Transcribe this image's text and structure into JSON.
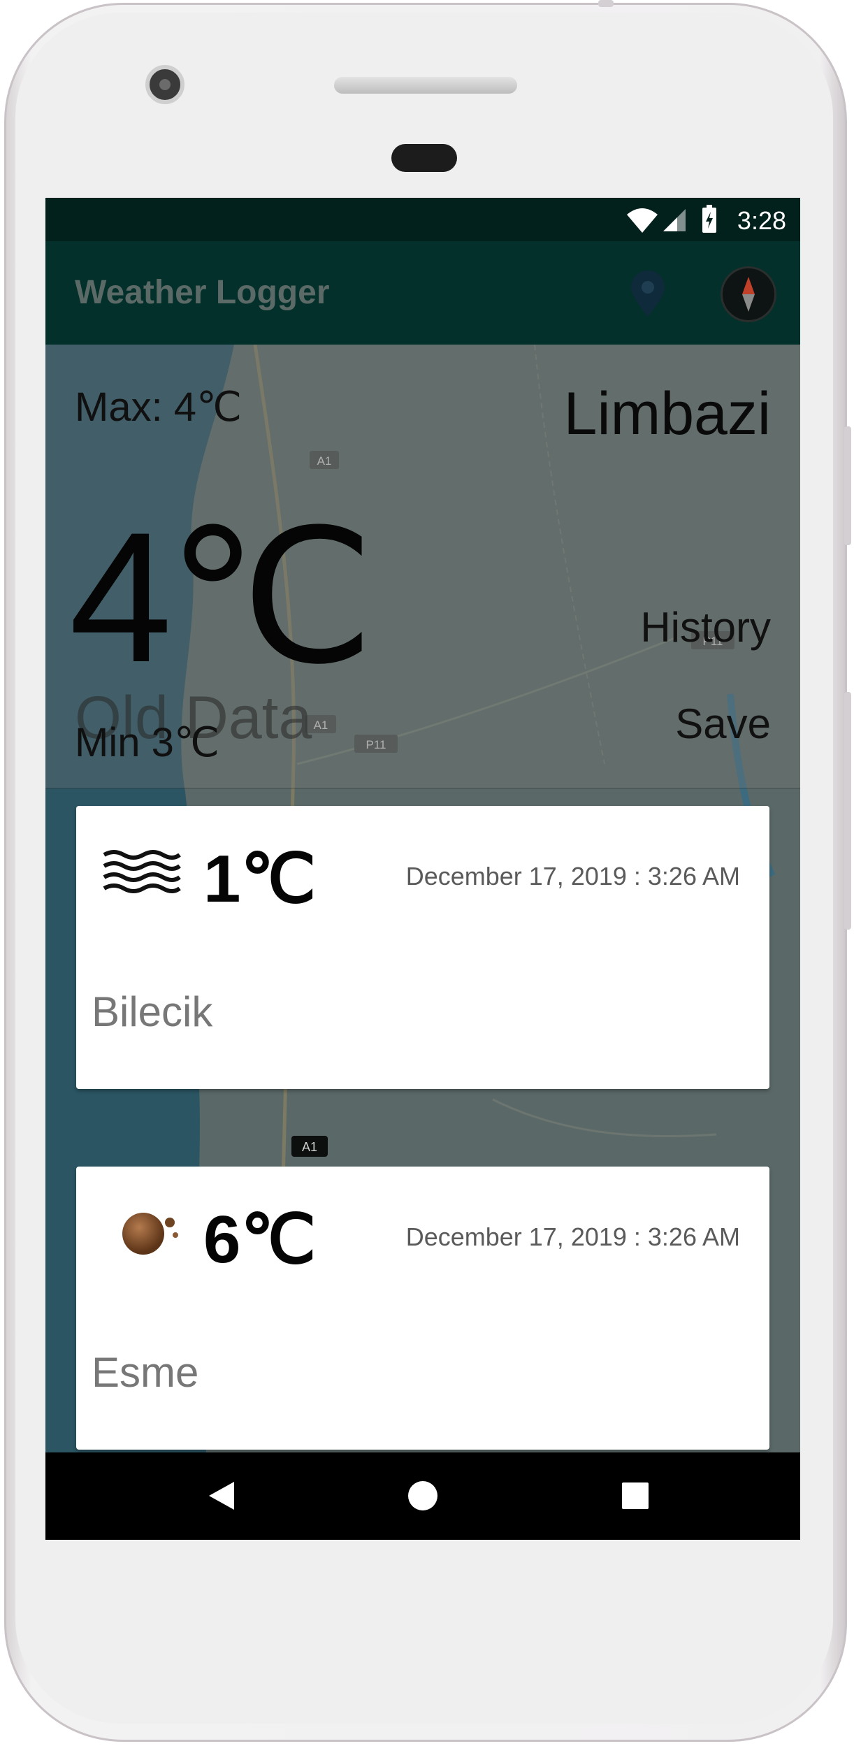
{
  "status_bar": {
    "time": "3:28"
  },
  "app_bar": {
    "title": "Weather Logger"
  },
  "current": {
    "max": "Max: 4℃",
    "city": "Limbazi",
    "temperature": "4℃",
    "stale_label": "Old Data",
    "min": "Min 3℃",
    "history_button": "History",
    "save_button": "Save"
  },
  "history": [
    {
      "icon": "mist-icon",
      "temperature": "1℃",
      "date": "December 17, 2019 : 3:26 AM",
      "city": "Bilecik"
    },
    {
      "icon": "overcast-cloud-icon",
      "temperature": "6℃",
      "date": "December 17, 2019 : 3:26 AM",
      "city": "Esme"
    }
  ],
  "map_labels": [
    "A1",
    "A1",
    "P11",
    "P11",
    "A1"
  ],
  "colors": {
    "status_bar": "#02201c",
    "app_bar": "#03302a",
    "title": "#5b6a66"
  }
}
